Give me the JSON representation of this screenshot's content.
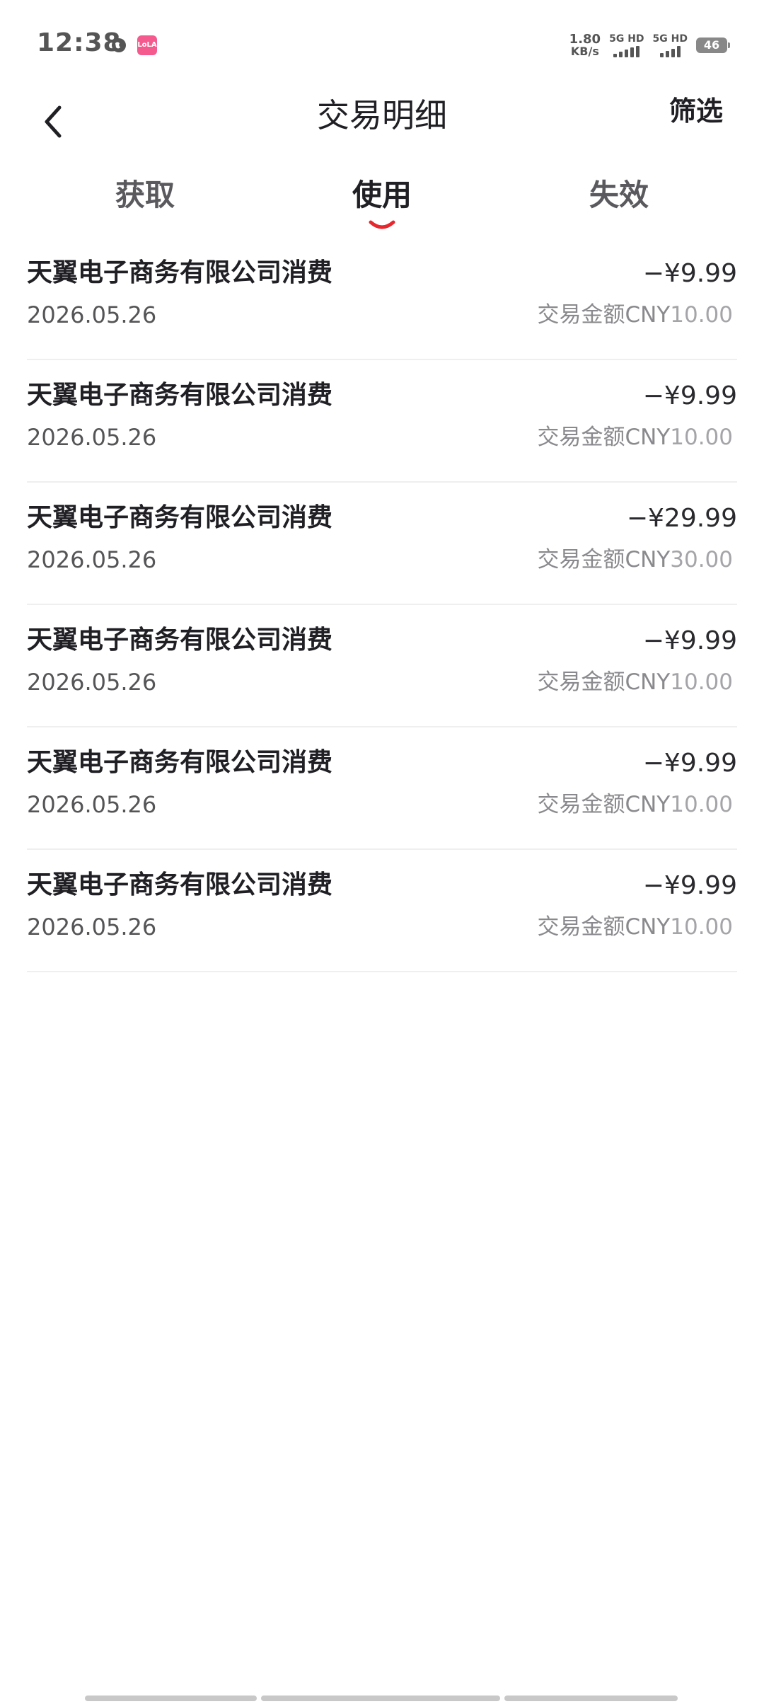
{
  "status_bar": {
    "time": "12:38",
    "app_badge": "LoLA",
    "net_speed": "1.80",
    "net_unit": "KB/s",
    "sim1_label": "5G HD",
    "sim2_label": "5G HD",
    "battery": "46"
  },
  "header": {
    "title": "交易明细",
    "filter_label": "筛选"
  },
  "tabs": [
    {
      "label": "获取",
      "active": false
    },
    {
      "label": "使用",
      "active": true
    },
    {
      "label": "失效",
      "active": false
    }
  ],
  "accent_color": "#e8262d",
  "transactions": [
    {
      "title": "天翼电子商务有限公司消费",
      "date": "2026.05.26",
      "amount": "−¥9.99",
      "sub_label": "交易金额",
      "sub_currency": "CNY",
      "sub_amount": "10.00"
    },
    {
      "title": "天翼电子商务有限公司消费",
      "date": "2026.05.26",
      "amount": "−¥9.99",
      "sub_label": "交易金额",
      "sub_currency": "CNY",
      "sub_amount": "10.00"
    },
    {
      "title": "天翼电子商务有限公司消费",
      "date": "2026.05.26",
      "amount": "−¥29.99",
      "sub_label": "交易金额",
      "sub_currency": "CNY",
      "sub_amount": "30.00"
    },
    {
      "title": "天翼电子商务有限公司消费",
      "date": "2026.05.26",
      "amount": "−¥9.99",
      "sub_label": "交易金额",
      "sub_currency": "CNY",
      "sub_amount": "10.00"
    },
    {
      "title": "天翼电子商务有限公司消费",
      "date": "2026.05.26",
      "amount": "−¥9.99",
      "sub_label": "交易金额",
      "sub_currency": "CNY",
      "sub_amount": "10.00"
    },
    {
      "title": "天翼电子商务有限公司消费",
      "date": "2026.05.26",
      "amount": "−¥9.99",
      "sub_label": "交易金额",
      "sub_currency": "CNY",
      "sub_amount": "10.00"
    }
  ]
}
